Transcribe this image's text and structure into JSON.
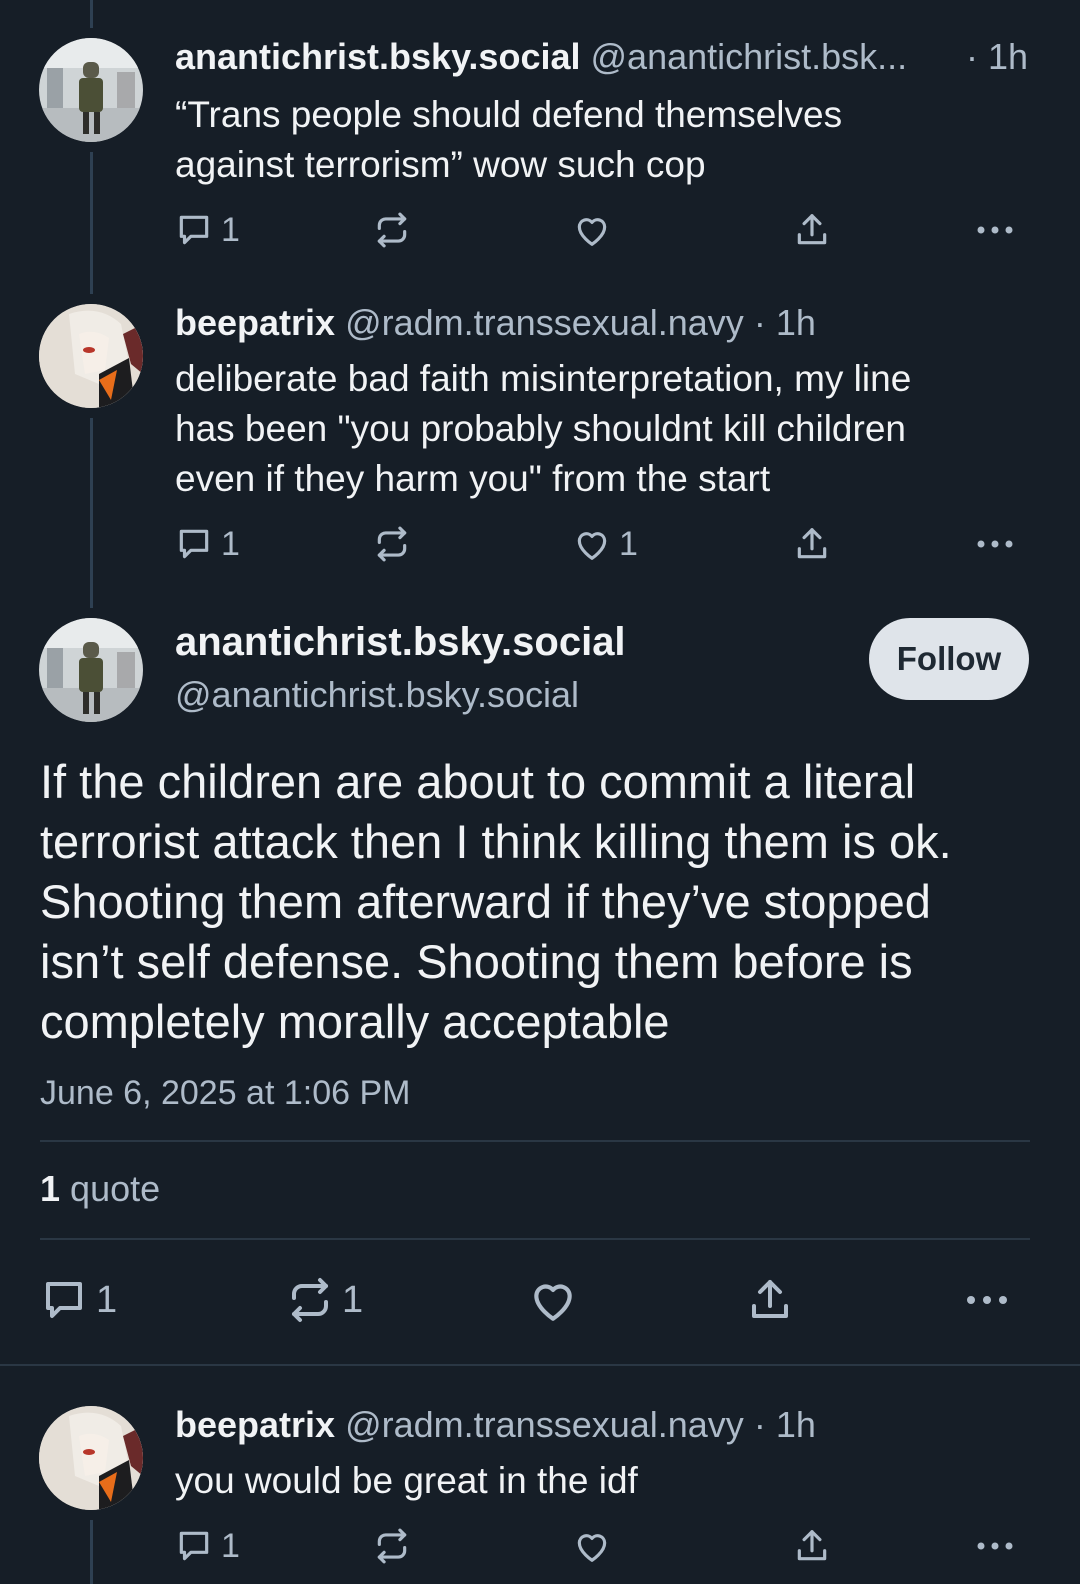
{
  "thread": [
    {
      "display_name": "anantichrist.bsky.social",
      "handle": "@anantichrist.bsk...",
      "time": "· 1h",
      "text_line1": "“Trans people should defend themselves",
      "text_line2": "against terrorism” wow such cop",
      "reply_count": "1",
      "repost_count": "",
      "like_count": ""
    },
    {
      "display_name": "beepatrix",
      "handle": "@radm.transsexual.navy",
      "time": "· 1h",
      "text_line1": "deliberate bad faith misinterpretation, my line",
      "text_line2": "has been \"you probably shouldnt kill children",
      "text_line3": "even if they harm you\" from the start",
      "reply_count": "1",
      "repost_count": "",
      "like_count": "1"
    }
  ],
  "focus_post": {
    "display_name": "anantichrist.bsky.social",
    "handle": "@anantichrist.bsky.social",
    "follow_label": "Follow",
    "text_lines": [
      "If the children are about to commit a literal",
      "terrorist attack then I think killing them is ok.",
      "Shooting them afterward if they’ve stopped",
      "isn’t self defense. Shooting them before is",
      "completely morally acceptable"
    ],
    "timestamp": "June 6, 2025 at 1:06 PM",
    "quote_count": "1",
    "quote_label": "quote",
    "reply_count": "1",
    "repost_count": "1",
    "like_count": ""
  },
  "reply": {
    "display_name": "beepatrix",
    "handle": "@radm.transsexual.navy",
    "time": "· 1h",
    "text": "you would be great in the idf",
    "reply_count": "1"
  },
  "colors": {
    "background": "#161e27",
    "text": "#f1f3f5",
    "muted": "#aebbc9",
    "thread_line": "#2e4052",
    "follow_button_bg": "#dfe4ea"
  },
  "icons": [
    "reply-icon",
    "repost-icon",
    "like-icon",
    "share-icon",
    "more-icon"
  ]
}
